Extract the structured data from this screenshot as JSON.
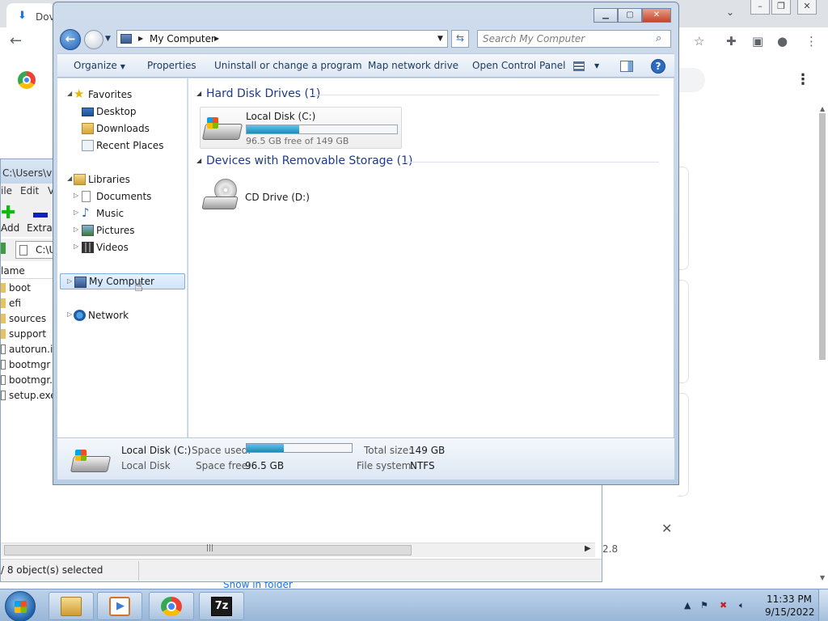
{
  "chrome": {
    "tab_title": "Dov",
    "download_item": {
      "version_fragment": "2.8",
      "show_in_folder": "Show in folder"
    }
  },
  "sevenzip": {
    "title": "C:\\Users\\vi",
    "menu": [
      "ile",
      "Edit",
      "V"
    ],
    "toolbar": {
      "add_label": "Add",
      "extract_label": "Extract"
    },
    "address": "C:\\U",
    "column_name": "lame",
    "items": [
      {
        "name": "boot",
        "type": "folder"
      },
      {
        "name": "efi",
        "type": "folder"
      },
      {
        "name": "sources",
        "type": "folder"
      },
      {
        "name": "support",
        "type": "folder"
      },
      {
        "name": "autorun.in",
        "type": "file"
      },
      {
        "name": "bootmgr",
        "type": "file"
      },
      {
        "name": "bootmgr.e",
        "type": "file"
      },
      {
        "name": "setup.exe",
        "type": "file"
      }
    ],
    "status": "/ 8 object(s) selected"
  },
  "explorer": {
    "address": {
      "location": "My Computer"
    },
    "search": {
      "placeholder": "Search My Computer"
    },
    "commands": {
      "organize": "Organize",
      "properties": "Properties",
      "uninstall": "Uninstall or change a program",
      "map_drive": "Map network drive",
      "control_panel": "Open Control Panel"
    },
    "nav": {
      "favorites": "Favorites",
      "desktop": "Desktop",
      "downloads": "Downloads",
      "recent": "Recent Places",
      "libraries": "Libraries",
      "documents": "Documents",
      "music": "Music",
      "pictures": "Pictures",
      "videos": "Videos",
      "computer": "My Computer",
      "network": "Network"
    },
    "groups": {
      "hard_disks": "Hard Disk Drives (1)",
      "removable": "Devices with Removable Storage (1)"
    },
    "drive_c": {
      "name": "Local Disk (C:)",
      "free_text": "96.5 GB free of 149 GB",
      "used_fraction": 0.352
    },
    "drive_d": {
      "name": "CD Drive (D:)"
    },
    "details": {
      "name": "Local Disk (C:)",
      "type": "Local Disk",
      "space_used_label": "Space used:",
      "space_free_label": "Space free:",
      "space_free": "96.5 GB",
      "total_size_label": "Total size:",
      "total_size": "149 GB",
      "filesystem_label": "File system:",
      "filesystem": "NTFS"
    }
  },
  "taskbar": {
    "sevenzip_label": "7z",
    "time": "11:33 PM",
    "date": "9/15/2022"
  }
}
